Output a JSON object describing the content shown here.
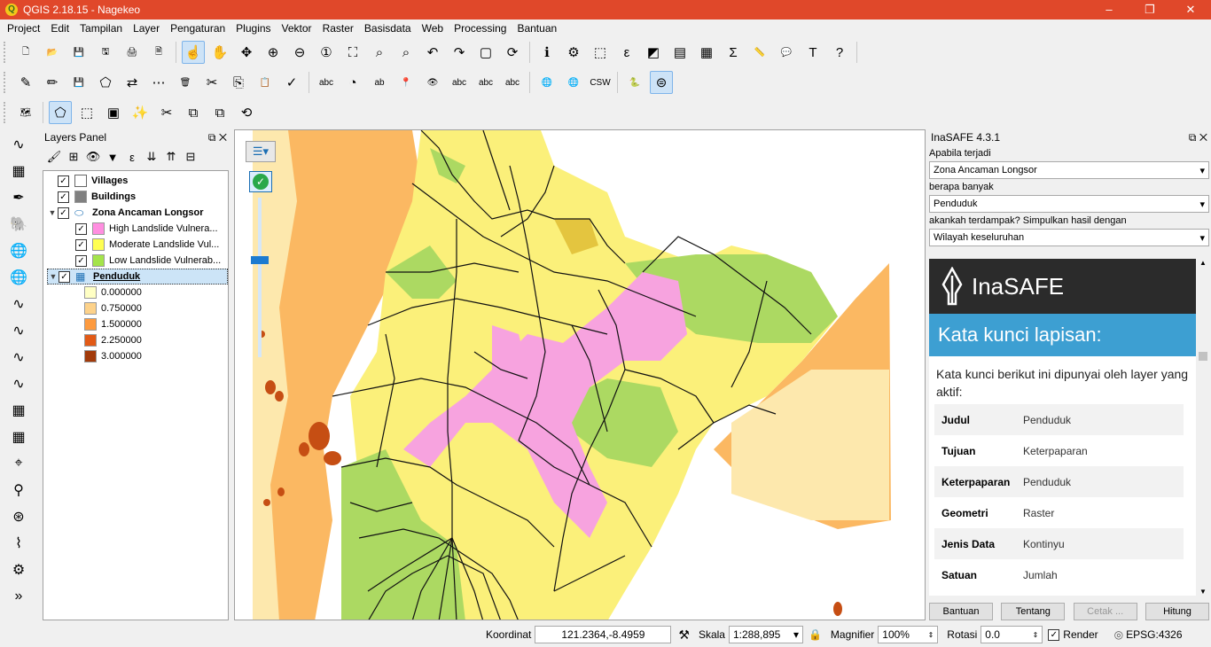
{
  "window": {
    "title": "QGIS 2.18.15 - Nagekeo",
    "minimize": "–",
    "maximize": "❐",
    "close": "✕"
  },
  "menu": [
    "Project",
    "Edit",
    "Tampilan",
    "Layer",
    "Pengaturan",
    "Plugins",
    "Vektor",
    "Raster",
    "Basisdata",
    "Web",
    "Processing",
    "Bantuan"
  ],
  "toolbar1": [
    {
      "name": "new-project-icon",
      "glyph": "🗋"
    },
    {
      "name": "open-project-icon",
      "glyph": "📂"
    },
    {
      "name": "save-project-icon",
      "glyph": "💾"
    },
    {
      "name": "save-as-icon",
      "glyph": "🖫"
    },
    {
      "name": "print-composer-icon",
      "glyph": "🖨"
    },
    {
      "name": "composer-manager-icon",
      "glyph": "🗎"
    },
    {
      "name": "touch-icon",
      "glyph": "☝",
      "selected": true
    },
    {
      "name": "pan-icon",
      "glyph": "✋"
    },
    {
      "name": "pan-to-selection-icon",
      "glyph": "✥"
    },
    {
      "name": "zoom-in-icon",
      "glyph": "⊕"
    },
    {
      "name": "zoom-out-icon",
      "glyph": "⊖"
    },
    {
      "name": "zoom-actual-icon",
      "glyph": "①"
    },
    {
      "name": "zoom-full-icon",
      "glyph": "⛶"
    },
    {
      "name": "zoom-selection-icon",
      "glyph": "⌕"
    },
    {
      "name": "zoom-layer-icon",
      "glyph": "⌕"
    },
    {
      "name": "zoom-last-icon",
      "glyph": "↶"
    },
    {
      "name": "zoom-next-icon",
      "glyph": "↷"
    },
    {
      "name": "new-map-view-icon",
      "glyph": "▢"
    },
    {
      "name": "refresh-icon",
      "glyph": "⟳"
    },
    {
      "name": "identify-icon",
      "glyph": "ℹ"
    },
    {
      "name": "run-action-icon",
      "glyph": "⚙"
    },
    {
      "name": "select-icon",
      "glyph": "⬚"
    },
    {
      "name": "select-expression-icon",
      "glyph": "ε"
    },
    {
      "name": "deselect-icon",
      "glyph": "◩"
    },
    {
      "name": "attribute-table-icon",
      "glyph": "▤"
    },
    {
      "name": "field-calculator-icon",
      "glyph": "▦"
    },
    {
      "name": "statistics-icon",
      "glyph": "Σ"
    },
    {
      "name": "measure-icon",
      "glyph": "📏"
    },
    {
      "name": "map-tips-icon",
      "glyph": "💬"
    },
    {
      "name": "text-annotation-icon",
      "glyph": "T"
    },
    {
      "name": "help-icon",
      "glyph": "?"
    }
  ],
  "toolbar2": [
    {
      "name": "current-edits-icon",
      "glyph": "✎"
    },
    {
      "name": "toggle-editing-icon",
      "glyph": "✏"
    },
    {
      "name": "save-edits-icon",
      "glyph": "💾"
    },
    {
      "name": "add-feature-icon",
      "glyph": "⬠"
    },
    {
      "name": "move-feature-icon",
      "glyph": "⇄"
    },
    {
      "name": "node-tool-icon",
      "glyph": "⋯"
    },
    {
      "name": "delete-selected-icon",
      "glyph": "🗑"
    },
    {
      "name": "cut-features-icon",
      "glyph": "✂"
    },
    {
      "name": "copy-features-icon",
      "glyph": "⎘"
    },
    {
      "name": "paste-features-icon",
      "glyph": "📋"
    },
    {
      "name": "undo-icon",
      "glyph": "✓"
    },
    {
      "name": "label-icon",
      "glyph": "abc"
    },
    {
      "name": "diagram-icon",
      "glyph": "◔"
    },
    {
      "name": "highlight-label-icon",
      "glyph": "ab"
    },
    {
      "name": "pin-label-icon",
      "glyph": "📍"
    },
    {
      "name": "show-hide-label-icon",
      "glyph": "👁"
    },
    {
      "name": "move-label-icon",
      "glyph": "abc"
    },
    {
      "name": "rotate-label-icon",
      "glyph": "abc"
    },
    {
      "name": "change-label-icon",
      "glyph": "abc"
    },
    {
      "name": "wms-icon",
      "glyph": "🌐"
    },
    {
      "name": "wfs-icon",
      "glyph": "🌐"
    },
    {
      "name": "csw-icon",
      "glyph": "CSW"
    },
    {
      "name": "python-icon",
      "glyph": "🐍"
    },
    {
      "name": "inasafe-toggle-icon",
      "glyph": "⊜",
      "selected": true
    }
  ],
  "toolbar3": [
    {
      "name": "digitizing-map-icon",
      "glyph": "🗺"
    },
    {
      "name": "add-ring-icon",
      "glyph": "⬠",
      "selected": true
    },
    {
      "name": "add-part-icon",
      "glyph": "⬚"
    },
    {
      "name": "fill-ring-icon",
      "glyph": "▣"
    },
    {
      "name": "magic-wand-icon",
      "glyph": "✨"
    },
    {
      "name": "split-features-icon",
      "glyph": "✂"
    },
    {
      "name": "merge-features-icon",
      "glyph": "⧉"
    },
    {
      "name": "merge-attributes-icon",
      "glyph": "⧉"
    },
    {
      "name": "rotate-symbols-icon",
      "glyph": "⟲"
    }
  ],
  "leftbar": [
    {
      "name": "add-vector-icon",
      "glyph": "∿"
    },
    {
      "name": "add-raster-icon",
      "glyph": "▦"
    },
    {
      "name": "add-spatialite-icon",
      "glyph": "✒"
    },
    {
      "name": "add-postgis-icon",
      "glyph": "🐘"
    },
    {
      "name": "add-wms-icon",
      "glyph": "🌐"
    },
    {
      "name": "add-wcs-icon",
      "glyph": "🌐"
    },
    {
      "name": "add-wfs-icon",
      "glyph": "∿"
    },
    {
      "name": "add-delimited-icon",
      "glyph": "∿"
    },
    {
      "name": "add-virtual-layer-icon",
      "glyph": "∿"
    },
    {
      "name": "new-shapefile-icon",
      "glyph": "∿"
    },
    {
      "name": "new-gpx-icon",
      "glyph": "▦"
    },
    {
      "name": "add-oracle-icon",
      "glyph": "▦"
    },
    {
      "name": "georeferencer-icon",
      "glyph": "⌖"
    },
    {
      "name": "coordinate-capture-icon",
      "glyph": "⚲"
    },
    {
      "name": "db-manager-icon",
      "glyph": "⊛"
    },
    {
      "name": "road-graph-icon",
      "glyph": "⌇"
    },
    {
      "name": "spatial-query-icon",
      "glyph": "⚙"
    },
    {
      "name": "more-tools-icon",
      "glyph": "»"
    }
  ],
  "layers_panel": {
    "title": "Layers Panel",
    "tools": [
      {
        "name": "style-manager-icon",
        "glyph": "🖌"
      },
      {
        "name": "add-group-icon",
        "glyph": "⊞"
      },
      {
        "name": "visibility-icon",
        "glyph": "👁"
      },
      {
        "name": "filter-legend-icon",
        "glyph": "▼"
      },
      {
        "name": "filter-expression-icon",
        "glyph": "ε"
      },
      {
        "name": "expand-all-icon",
        "glyph": "⇊"
      },
      {
        "name": "collapse-all-icon",
        "glyph": "⇈"
      },
      {
        "name": "remove-layer-icon",
        "glyph": "⊟"
      }
    ],
    "layers": [
      {
        "label": "Villages",
        "checked": true,
        "color": "#ffffff",
        "bold": true,
        "expand": ""
      },
      {
        "label": "Buildings",
        "checked": true,
        "color": "#808080",
        "bold": true,
        "expand": ""
      },
      {
        "label": "Zona Ancaman Longsor",
        "checked": true,
        "color": "",
        "bold": true,
        "expand": "▼"
      },
      {
        "label": "High Landslide Vulnera...",
        "checked": true,
        "color": "#ff8ee0",
        "bold": false,
        "expand": "",
        "indent": 1
      },
      {
        "label": "Moderate Landslide Vul...",
        "checked": true,
        "color": "#ffff52",
        "bold": false,
        "expand": "",
        "indent": 1
      },
      {
        "label": "Low Landslide Vulnerab...",
        "checked": true,
        "color": "#a4e44a",
        "bold": false,
        "expand": "",
        "indent": 1
      },
      {
        "label": "Penduduk",
        "checked": true,
        "color": "",
        "bold": true,
        "expand": "▼",
        "selected": true
      },
      {
        "label": "0.000000",
        "checked": null,
        "color": "#ffffc4",
        "bold": false,
        "expand": "",
        "indent": 1
      },
      {
        "label": "0.750000",
        "checked": null,
        "color": "#fdd28a",
        "bold": false,
        "expand": "",
        "indent": 1
      },
      {
        "label": "1.500000",
        "checked": null,
        "color": "#fd9a3e",
        "bold": false,
        "expand": "",
        "indent": 1
      },
      {
        "label": "2.250000",
        "checked": null,
        "color": "#e25a16",
        "bold": false,
        "expand": "",
        "indent": 1
      },
      {
        "label": "3.000000",
        "checked": null,
        "color": "#a23a0a",
        "bold": false,
        "expand": "",
        "indent": 1
      }
    ]
  },
  "inasafe": {
    "title": "InaSAFE 4.3.1",
    "q1": "Apabila terjadi",
    "hazard": "Zona Ancaman Longsor",
    "q2": "berapa banyak",
    "exposure": "Penduduk",
    "q3": "akankah terdampak? Simpulkan hasil dengan",
    "aggregation": "Wilayah keseluruhan",
    "logo": "InaSAFE",
    "report_title": "Kata kunci lapisan:",
    "report_intro": "Kata kunci berikut ini dipunyai oleh layer yang aktif:",
    "keywords": [
      {
        "key": "Judul",
        "value": "Penduduk"
      },
      {
        "key": "Tujuan",
        "value": "Keterpaparan"
      },
      {
        "key": "Keterpaparan",
        "value": "Penduduk"
      },
      {
        "key": "Geometri",
        "value": "Raster"
      },
      {
        "key": "Jenis Data",
        "value": "Kontinyu"
      },
      {
        "key": "Satuan",
        "value": "Jumlah"
      }
    ],
    "buttons": {
      "help": "Bantuan",
      "about": "Tentang",
      "print": "Cetak ...",
      "run": "Hitung"
    }
  },
  "status": {
    "coord_label": "Koordinat",
    "coord_value": "121.2364,-8.4959",
    "scale_label": "Skala",
    "scale_value": "1:288,895",
    "magnifier_label": "Magnifier",
    "magnifier_value": "100%",
    "rotation_label": "Rotasi",
    "rotation_value": "0.0",
    "render_label": "Render",
    "crs": "EPSG:4326"
  },
  "colors": {
    "title_bar": "#e0482a",
    "map_light": "#fde8ad",
    "map_orange": "#fbb862",
    "map_dark": "#c64e13",
    "zone_high": "#f7a3df",
    "zone_moderate": "#fbf07a",
    "zone_low": "#acd962",
    "inasafe_blue": "#3d9fd2"
  }
}
